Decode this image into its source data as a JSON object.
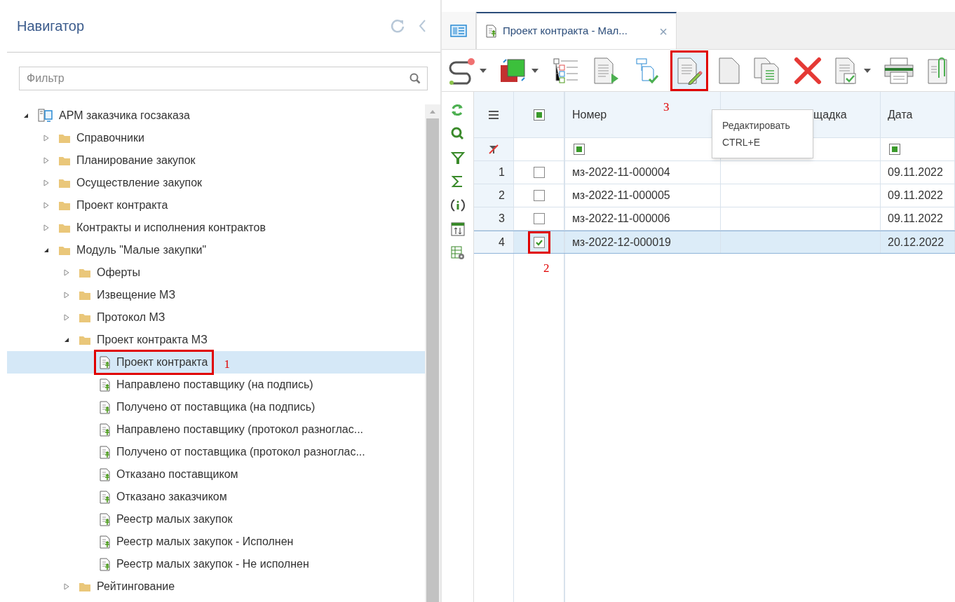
{
  "navigator": {
    "title": "Навигатор",
    "filter": {
      "placeholder": "Фильтр"
    },
    "tree": [
      {
        "label": "АРМ заказчика госзаказа",
        "kind": "root",
        "expanded": true,
        "selected": false,
        "children": [
          {
            "label": "Справочники",
            "kind": "folder",
            "expanded": false,
            "selected": false
          },
          {
            "label": "Планирование закупок",
            "kind": "folder",
            "expanded": false,
            "selected": false
          },
          {
            "label": "Осуществление закупок",
            "kind": "folder",
            "expanded": false,
            "selected": false
          },
          {
            "label": "Проект контракта",
            "kind": "folder",
            "expanded": false,
            "selected": false
          },
          {
            "label": "Контракты и исполнения контрактов",
            "kind": "folder",
            "expanded": false,
            "selected": false
          },
          {
            "label": "Модуль \"Малые закупки\"",
            "kind": "folder",
            "expanded": true,
            "selected": false,
            "children": [
              {
                "label": "Оферты",
                "kind": "folder",
                "expanded": false,
                "selected": false
              },
              {
                "label": "Извещение МЗ",
                "kind": "folder",
                "expanded": false,
                "selected": false
              },
              {
                "label": "Протокол МЗ",
                "kind": "folder",
                "expanded": false,
                "selected": false
              },
              {
                "label": "Проект контракта МЗ",
                "kind": "folder",
                "expanded": true,
                "selected": false,
                "children": [
                  {
                    "label": "Проект контракта",
                    "kind": "document",
                    "selected": true,
                    "callout": "1"
                  },
                  {
                    "label": "Направлено поставщику (на подпись)",
                    "kind": "document",
                    "selected": false
                  },
                  {
                    "label": "Получено от поставщика (на подпись)",
                    "kind": "document",
                    "selected": false
                  },
                  {
                    "label": "Направлено поставщику (протокол разноглас...",
                    "kind": "document",
                    "selected": false
                  },
                  {
                    "label": "Получено от поставщика (протокол разноглас...",
                    "kind": "document",
                    "selected": false
                  },
                  {
                    "label": "Отказано поставщиком",
                    "kind": "document",
                    "selected": false
                  },
                  {
                    "label": "Отказано заказчиком",
                    "kind": "document",
                    "selected": false
                  },
                  {
                    "label": "Реестр малых закупок",
                    "kind": "document",
                    "selected": false
                  },
                  {
                    "label": "Реестр малых закупок - Исполнен",
                    "kind": "document",
                    "selected": false
                  },
                  {
                    "label": "Реестр малых закупок - Не исполнен",
                    "kind": "document",
                    "selected": false
                  }
                ]
              },
              {
                "label": "Рейтингование",
                "kind": "folder",
                "expanded": false,
                "selected": false
              }
            ]
          }
        ]
      }
    ]
  },
  "tabs": [
    {
      "kind": "home",
      "selected": false
    },
    {
      "kind": "document",
      "label": "Проект контракта - Мал...",
      "close": "×",
      "selected": true
    }
  ],
  "toolbar": [
    {
      "kind": "route",
      "dropdown": true
    },
    {
      "kind": "color",
      "dropdown": true
    },
    {
      "kind": "tree-list",
      "dropdown": false
    },
    {
      "kind": "doc-play",
      "dropdown": false
    },
    {
      "kind": "doc-check",
      "dropdown": false
    },
    {
      "kind": "edit",
      "dropdown": false,
      "callout": "3"
    },
    {
      "kind": "blank",
      "dropdown": false
    },
    {
      "kind": "copy",
      "dropdown": false
    },
    {
      "kind": "delete",
      "dropdown": false
    },
    {
      "kind": "doc-approve",
      "dropdown": true
    },
    {
      "kind": "print",
      "dropdown": false
    },
    {
      "kind": "attach",
      "dropdown": false
    }
  ],
  "tooltip": {
    "title": "Редактировать",
    "shortcut": "CTRL+E"
  },
  "side_tools": [
    {
      "kind": "refresh"
    },
    {
      "kind": "search"
    },
    {
      "kind": "filter"
    },
    {
      "kind": "sum"
    },
    {
      "kind": "info"
    },
    {
      "kind": "sort"
    },
    {
      "kind": "settings"
    }
  ],
  "table": {
    "select_all": {
      "indeterminate": true
    },
    "columns": [
      {
        "label": "Номер",
        "filter_indeterminate": true
      },
      {
        "label": "щадка"
      },
      {
        "label": "Дата",
        "filter_indeterminate": true
      }
    ],
    "rows": [
      {
        "index": "1",
        "checked": false,
        "selected": false,
        "cells": [
          "мз-2022-11-000004",
          "",
          "09.11.2022"
        ]
      },
      {
        "index": "2",
        "checked": false,
        "selected": false,
        "cells": [
          "мз-2022-11-000005",
          "",
          "09.11.2022"
        ]
      },
      {
        "index": "3",
        "checked": false,
        "selected": false,
        "cells": [
          "мз-2022-11-000006",
          "",
          "09.11.2022"
        ]
      },
      {
        "index": "4",
        "checked": true,
        "selected": true,
        "callout": "2",
        "cells": [
          "мз-2022-12-000019",
          "",
          "20.12.2022"
        ]
      }
    ]
  }
}
